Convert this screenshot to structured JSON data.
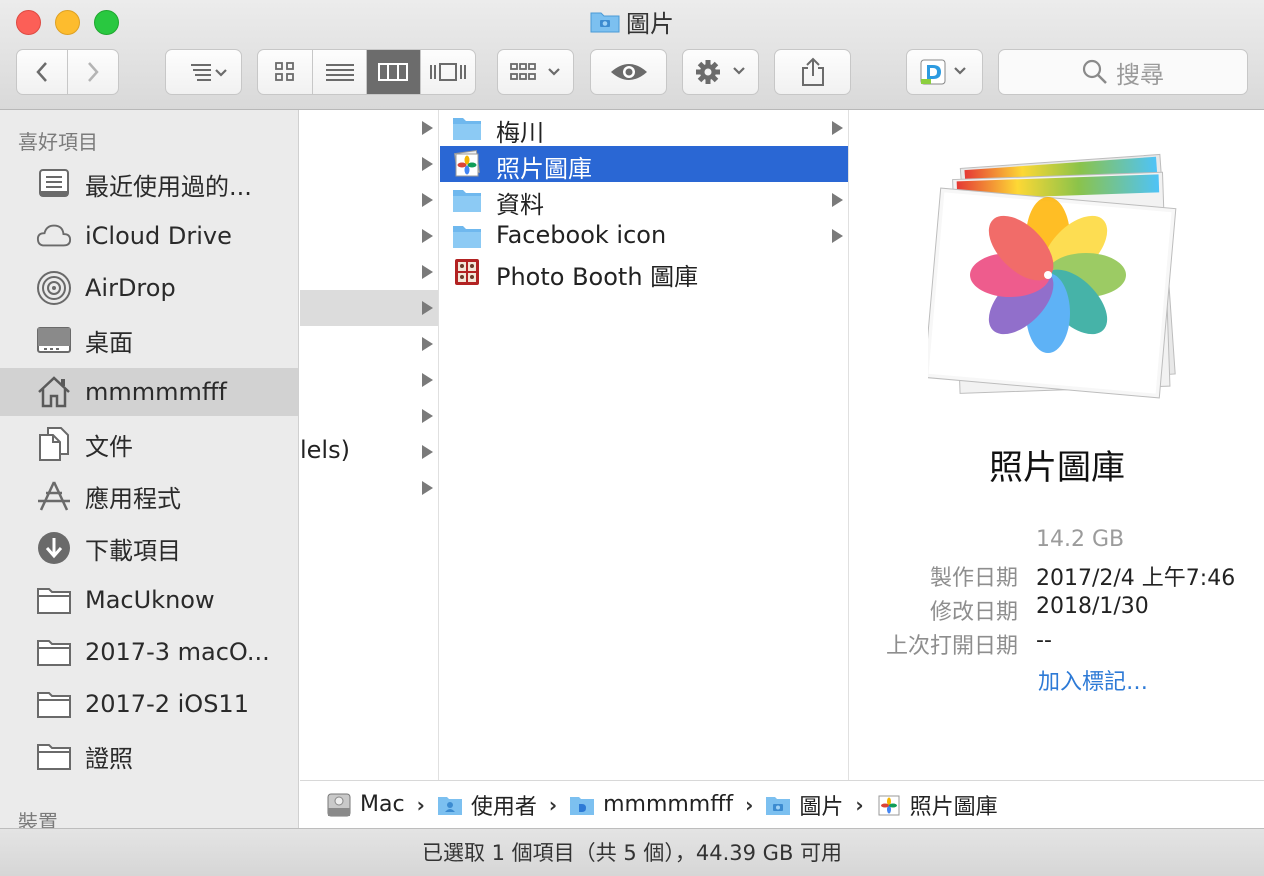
{
  "window": {
    "title": "圖片",
    "colors": {
      "selection": "#2a67d4",
      "folder": "#6fb8ee",
      "link": "#2d7ad6"
    }
  },
  "toolbar": {
    "back_icon": "chevron-left-icon",
    "forward_icon": "chevron-right-icon",
    "sort_icon": "list-sort-icon",
    "view_modes": [
      "icon-view",
      "list-view",
      "column-view",
      "cover-flow-view"
    ],
    "active_view": "column-view",
    "group_icon": "grid-group-icon",
    "quicklook_icon": "eye-icon",
    "action_icon": "gear-icon",
    "share_icon": "share-icon",
    "app_icon": "dropzone-app-icon",
    "search_placeholder": "搜尋"
  },
  "sidebar": {
    "favorites_header": "喜好項目",
    "devices_header": "裝置",
    "items": [
      {
        "label": "最近使用過的...",
        "icon": "recents-icon"
      },
      {
        "label": "iCloud Drive",
        "icon": "cloud-icon"
      },
      {
        "label": "AirDrop",
        "icon": "airdrop-icon"
      },
      {
        "label": "桌面",
        "icon": "desktop-icon"
      },
      {
        "label": "mmmmmfff",
        "icon": "home-icon",
        "selected": true
      },
      {
        "label": "文件",
        "icon": "documents-icon"
      },
      {
        "label": "應用程式",
        "icon": "applications-icon"
      },
      {
        "label": "下載項目",
        "icon": "downloads-icon"
      },
      {
        "label": "MacUknow",
        "icon": "folder-icon"
      },
      {
        "label": "2017-3 macO...",
        "icon": "folder-icon"
      },
      {
        "label": "2017-2 iOS11",
        "icon": "folder-icon"
      },
      {
        "label": "證照",
        "icon": "folder-icon"
      }
    ]
  },
  "column1": {
    "partial_text": "lels)",
    "rows": 11,
    "selected_row": 5
  },
  "column2": {
    "items": [
      {
        "label": "梅川",
        "icon": "folder-icon",
        "has_children": true
      },
      {
        "label": "照片圖庫",
        "icon": "photos-library-icon",
        "has_children": false,
        "selected": true
      },
      {
        "label": "資料",
        "icon": "folder-icon",
        "has_children": true
      },
      {
        "label": "Facebook icon",
        "icon": "folder-icon",
        "has_children": true
      },
      {
        "label": "Photo Booth 圖庫",
        "icon": "photo-booth-icon",
        "has_children": false
      }
    ]
  },
  "preview": {
    "name": "照片圖庫",
    "size": "14.2 GB",
    "created_key": "製作日期",
    "created_val": "2017/2/4 上午7:46",
    "modified_key": "修改日期",
    "modified_val": "2018/1/30",
    "opened_key": "上次打開日期",
    "opened_val": "--",
    "add_tags": "加入標記…"
  },
  "pathbar": {
    "crumbs": [
      {
        "label": "Mac",
        "icon": "hard-drive-icon"
      },
      {
        "label": "使用者",
        "icon": "users-folder-icon"
      },
      {
        "label": "mmmmmfff",
        "icon": "home-folder-icon"
      },
      {
        "label": "圖片",
        "icon": "pictures-folder-icon"
      },
      {
        "label": "照片圖庫",
        "icon": "photos-library-icon"
      }
    ]
  },
  "status": {
    "text": "已選取 1 個項目（共 5 個），44.39 GB 可用"
  }
}
